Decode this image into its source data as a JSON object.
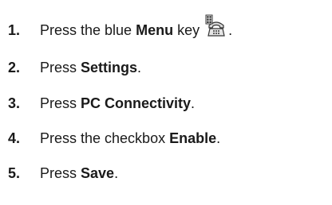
{
  "steps": [
    {
      "number": "1.",
      "text_before": "Press the blue ",
      "bold": "Menu",
      "text_after": " key",
      "icon": "phone-menu-key-icon",
      "punctuation": "."
    },
    {
      "number": "2.",
      "text_before": "Press ",
      "bold": "Settings",
      "punctuation": "."
    },
    {
      "number": "3.",
      "text_before": "Press ",
      "bold": "PC Connectivity",
      "punctuation": "."
    },
    {
      "number": "4.",
      "text_before": "Press the checkbox ",
      "bold": "Enable",
      "punctuation": "."
    },
    {
      "number": "5.",
      "text_before": "Press ",
      "bold": "Save",
      "punctuation": "."
    }
  ]
}
